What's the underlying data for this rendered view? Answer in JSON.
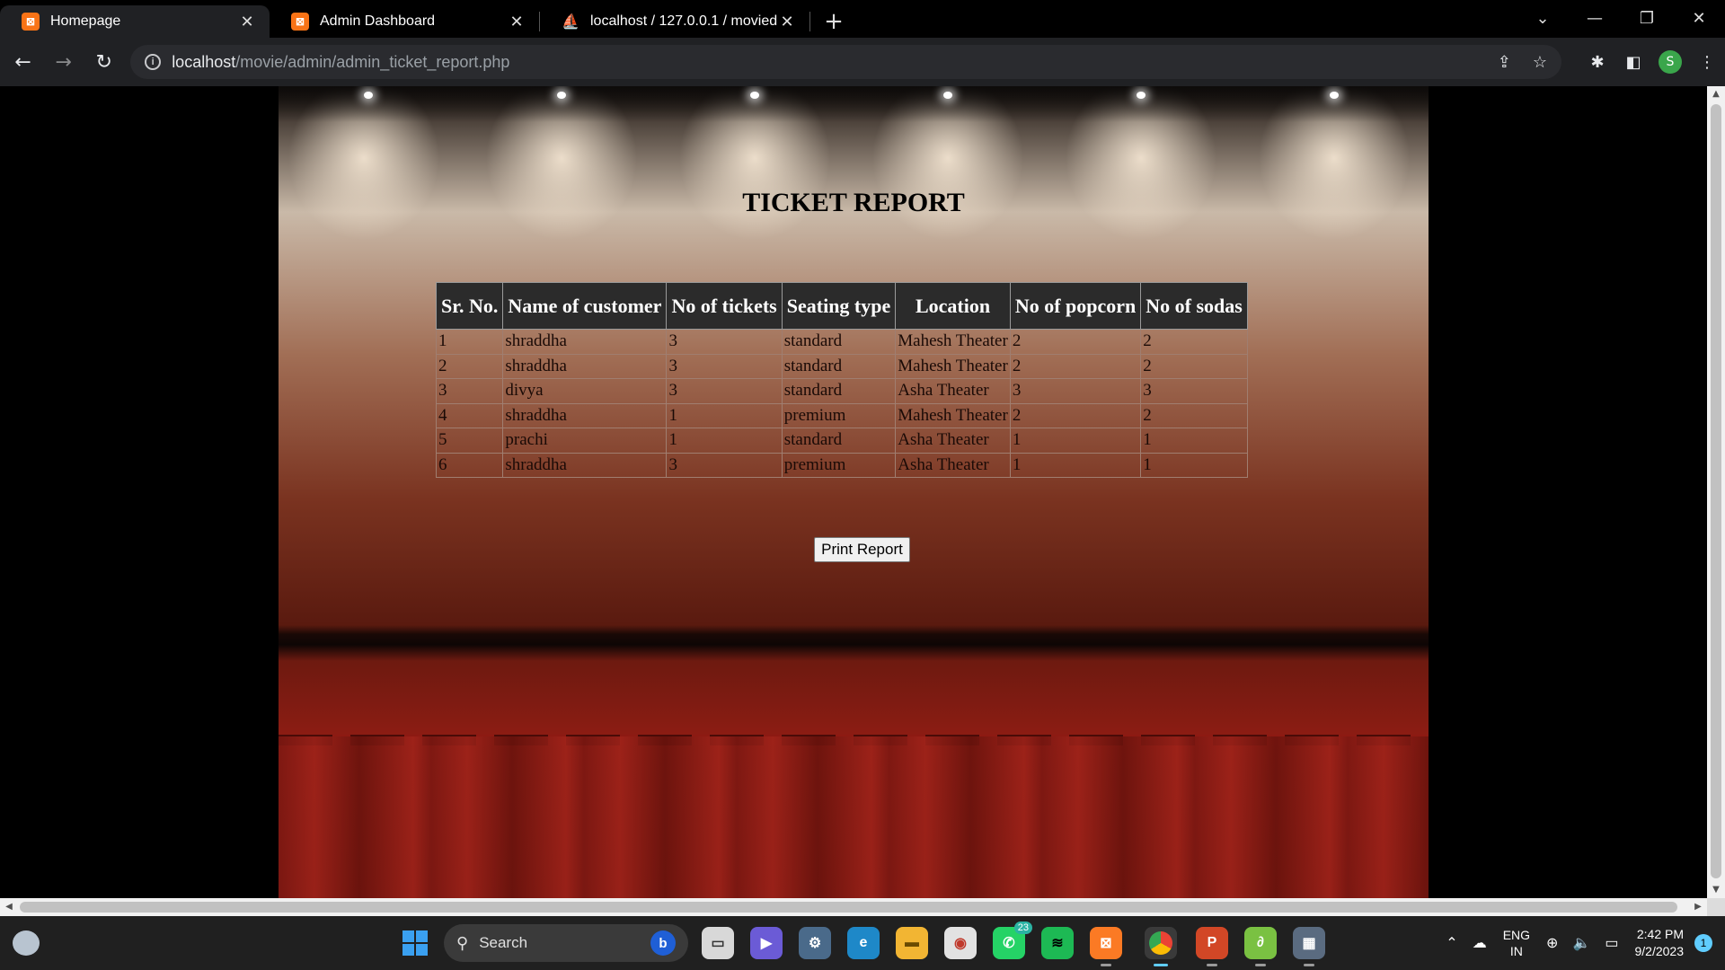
{
  "browser": {
    "tabs": [
      {
        "title": "Homepage",
        "favicon": "xampp-icon",
        "active": true
      },
      {
        "title": "Admin Dashboard",
        "favicon": "xampp-icon",
        "active": false
      },
      {
        "title": "localhost / 127.0.0.1 / moviedb /",
        "favicon": "phpmyadmin-icon",
        "active": false
      }
    ],
    "url_host": "localhost",
    "url_path": "/movie/admin/admin_ticket_report.php",
    "profile_initial": "S"
  },
  "page": {
    "title": "TICKET REPORT",
    "columns": [
      "Sr. No.",
      "Name of customer",
      "No of tickets",
      "Seating type",
      "Location",
      "No of popcorn",
      "No of sodas"
    ],
    "rows": [
      [
        "1",
        "shraddha",
        "3",
        "standard",
        "Mahesh Theater",
        "2",
        "2"
      ],
      [
        "2",
        "shraddha",
        "3",
        "standard",
        "Mahesh Theater",
        "2",
        "2"
      ],
      [
        "3",
        "divya",
        "3",
        "standard",
        "Asha Theater",
        "3",
        "3"
      ],
      [
        "4",
        "shraddha",
        "1",
        "premium",
        "Mahesh Theater",
        "2",
        "2"
      ],
      [
        "5",
        "prachi",
        "1",
        "standard",
        "Asha Theater",
        "1",
        "1"
      ],
      [
        "6",
        "shraddha",
        "3",
        "premium",
        "Asha Theater",
        "1",
        "1"
      ]
    ],
    "print_button": "Print Report"
  },
  "taskbar": {
    "search_label": "Search",
    "whatsapp_badge": "23",
    "lang_top": "ENG",
    "lang_bottom": "IN",
    "time": "2:42 PM",
    "date": "9/2/2023",
    "notifications": "1"
  },
  "colors": {
    "table_header_bg": "#2b2b2b",
    "chrome_bg": "#202124",
    "accent": "#60cdff"
  }
}
